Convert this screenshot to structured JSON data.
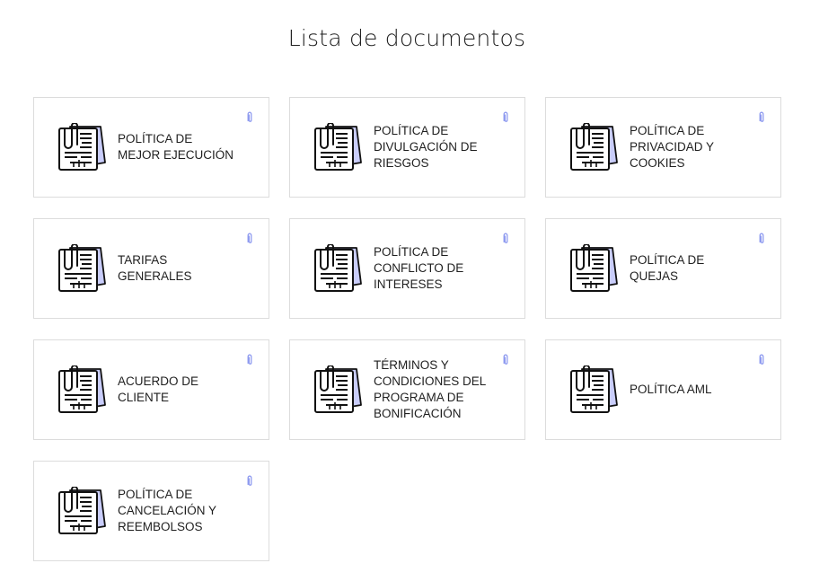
{
  "page": {
    "title": "Lista de documentos"
  },
  "colors": {
    "accent": "#8f9bf0",
    "card_border": "#dcdcdc",
    "icon_stroke": "#111111",
    "icon_fill_back": "#c9cdfb"
  },
  "icons": {
    "document": "document-icon",
    "attachment": "paperclip-icon"
  },
  "documents": [
    {
      "label": "POLÍTICA DE\nMEJOR EJECUCIÓN"
    },
    {
      "label": "POLÍTICA DE\nDIVULGACIÓN DE\nRIESGOS"
    },
    {
      "label": "POLÍTICA DE\nPRIVACIDAD Y\nCOOKIES"
    },
    {
      "label": "TARIFAS\nGENERALES"
    },
    {
      "label": "POLÍTICA DE\nCONFLICTO DE\nINTERESES"
    },
    {
      "label": "POLÍTICA DE\nQUEJAS"
    },
    {
      "label": "ACUERDO DE\nCLIENTE"
    },
    {
      "label": "TÉRMINOS Y\nCONDICIONES DEL\nPROGRAMA DE\nBONIFICACIÓN"
    },
    {
      "label": "POLÍTICA AML"
    },
    {
      "label": "POLÍTICA DE\nCANCELACIÓN Y\nREEMBOLSOS"
    }
  ]
}
